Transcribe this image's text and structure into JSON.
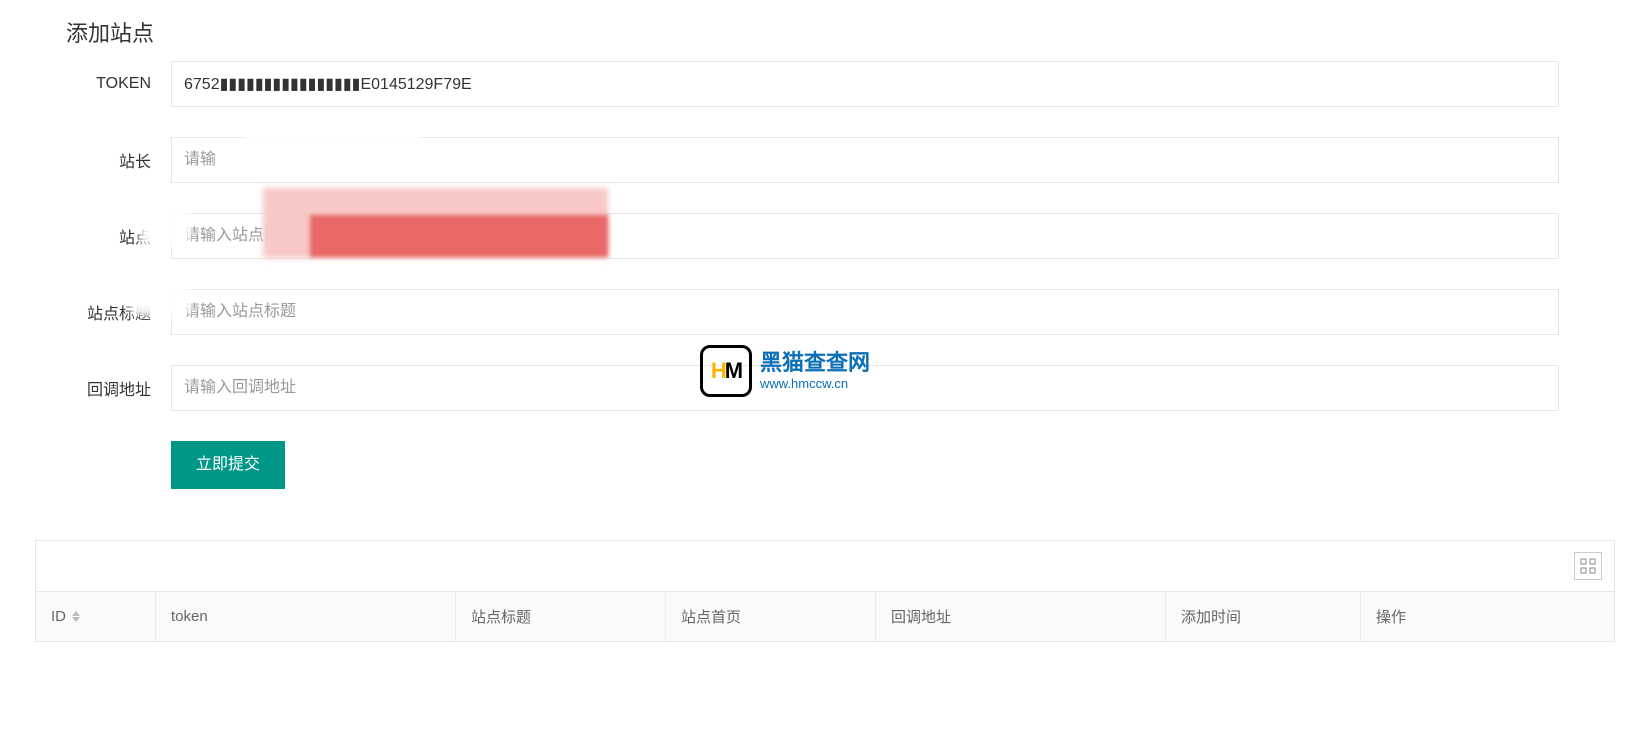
{
  "form": {
    "legend": "添加站点",
    "fields": {
      "token": {
        "label": "TOKEN",
        "value_visible_prefix": "6752",
        "value_visible_suffix": "E0145129F79E"
      },
      "owner": {
        "label": "站长",
        "placeholder_partial": "请输"
      },
      "homepage": {
        "label": "站点",
        "placeholder": "请输入站点首页"
      },
      "title": {
        "label": "站点标题",
        "placeholder": "请输入站点标题"
      },
      "callback": {
        "label": "回调地址",
        "placeholder": "请输入回调地址"
      }
    },
    "submit_label": "立即提交"
  },
  "table": {
    "columns": {
      "id": "ID",
      "token": "token",
      "title": "站点标题",
      "homepage": "站点首页",
      "callback": "回调地址",
      "add_time": "添加时间",
      "action": "操作"
    }
  },
  "watermark": {
    "logo_text": "HM",
    "title": "黑猫查查网",
    "url": "www.hmccw.cn"
  },
  "colors": {
    "primary": "#009688",
    "border": "#e6e6e6",
    "placeholder": "#999",
    "watermark_text": "#0b6fb8"
  }
}
